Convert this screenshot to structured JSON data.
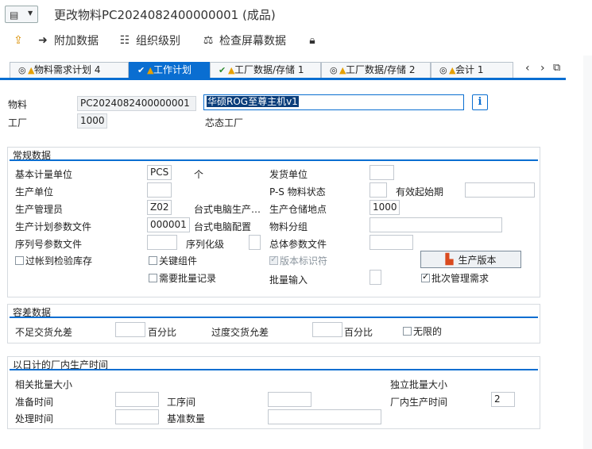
{
  "window": {
    "title": "更改物料PC2024082400000001 (成品)"
  },
  "toolbar": {
    "additional_data": "附加数据",
    "org_levels": "组织级别",
    "check_screen_data": "检查屏幕数据"
  },
  "tabs": [
    {
      "label": "物料需求计划 4"
    },
    {
      "label": "工作计划"
    },
    {
      "label": "工厂数据/存储 1"
    },
    {
      "label": "工厂数据/存储 2"
    },
    {
      "label": "会计 1"
    }
  ],
  "header": {
    "material_label": "物料",
    "material_value": "PC2024082400000001",
    "material_desc": "华硕ROG至尊主机v1",
    "plant_label": "工厂",
    "plant_value": "1000",
    "plant_desc": "芯态工厂"
  },
  "general": {
    "title": "常规数据",
    "base_uom_label": "基本计量单位",
    "base_uom_value": "PCS",
    "base_uom_text": "个",
    "issue_unit_label": "发货单位",
    "issue_unit_value": "",
    "prod_unit_label": "生产单位",
    "prod_unit_value": "",
    "ps_status_label": "P-S 物料状态",
    "ps_status_value": "",
    "valid_from_label": "有效起始期",
    "valid_from_value": "",
    "prod_sup_label": "生产管理员",
    "prod_sup_value": "Z02",
    "prod_sup_text": "台式电脑生产…",
    "prod_sloc_label": "生产仓储地点",
    "prod_sloc_value": "1000",
    "prod_sched_profile_label": "生产计划参数文件",
    "prod_sched_profile_value": "000001",
    "prod_sched_profile_text": "台式电脑配置",
    "material_group_label": "物料分组",
    "material_group_value": "",
    "serial_profile_label": "序列号参数文件",
    "serial_profile_value": "",
    "serial_level_label": "序列化级",
    "serial_level_value": "",
    "overall_profile_label": "总体参数文件",
    "overall_profile_value": "",
    "post_to_insp_label": "过帐到检验库存",
    "critical_part_label": "关键组件",
    "version_indicator_label": "版本标识符",
    "batch_record_label": "需要批量记录",
    "batch_entry_label": "批量输入",
    "batch_entry_value": "",
    "prod_version_button": "生产版本",
    "batch_mgmt_label": "批次管理需求"
  },
  "tolerance": {
    "title": "容差数据",
    "under_delivery_label": "不足交货允差",
    "under_delivery_value": "",
    "pct1": "百分比",
    "over_delivery_label": "过度交货允差",
    "over_delivery_value": "",
    "pct2": "百分比",
    "unlimited_label": "无限的"
  },
  "inhouse": {
    "title": "以日计的厂内生产时间",
    "lot_dep_label": "相关批量大小",
    "lot_indep_label": "独立批量大小",
    "setup_label": "准备时间",
    "setup_value": "",
    "interop_label": "工序间",
    "interop_value": "",
    "inhouse_prod_label": "厂内生产时间",
    "inhouse_prod_value": "2",
    "processing_label": "处理时间",
    "processing_value": "",
    "base_qty_label": "基准数量",
    "base_qty_value": ""
  }
}
